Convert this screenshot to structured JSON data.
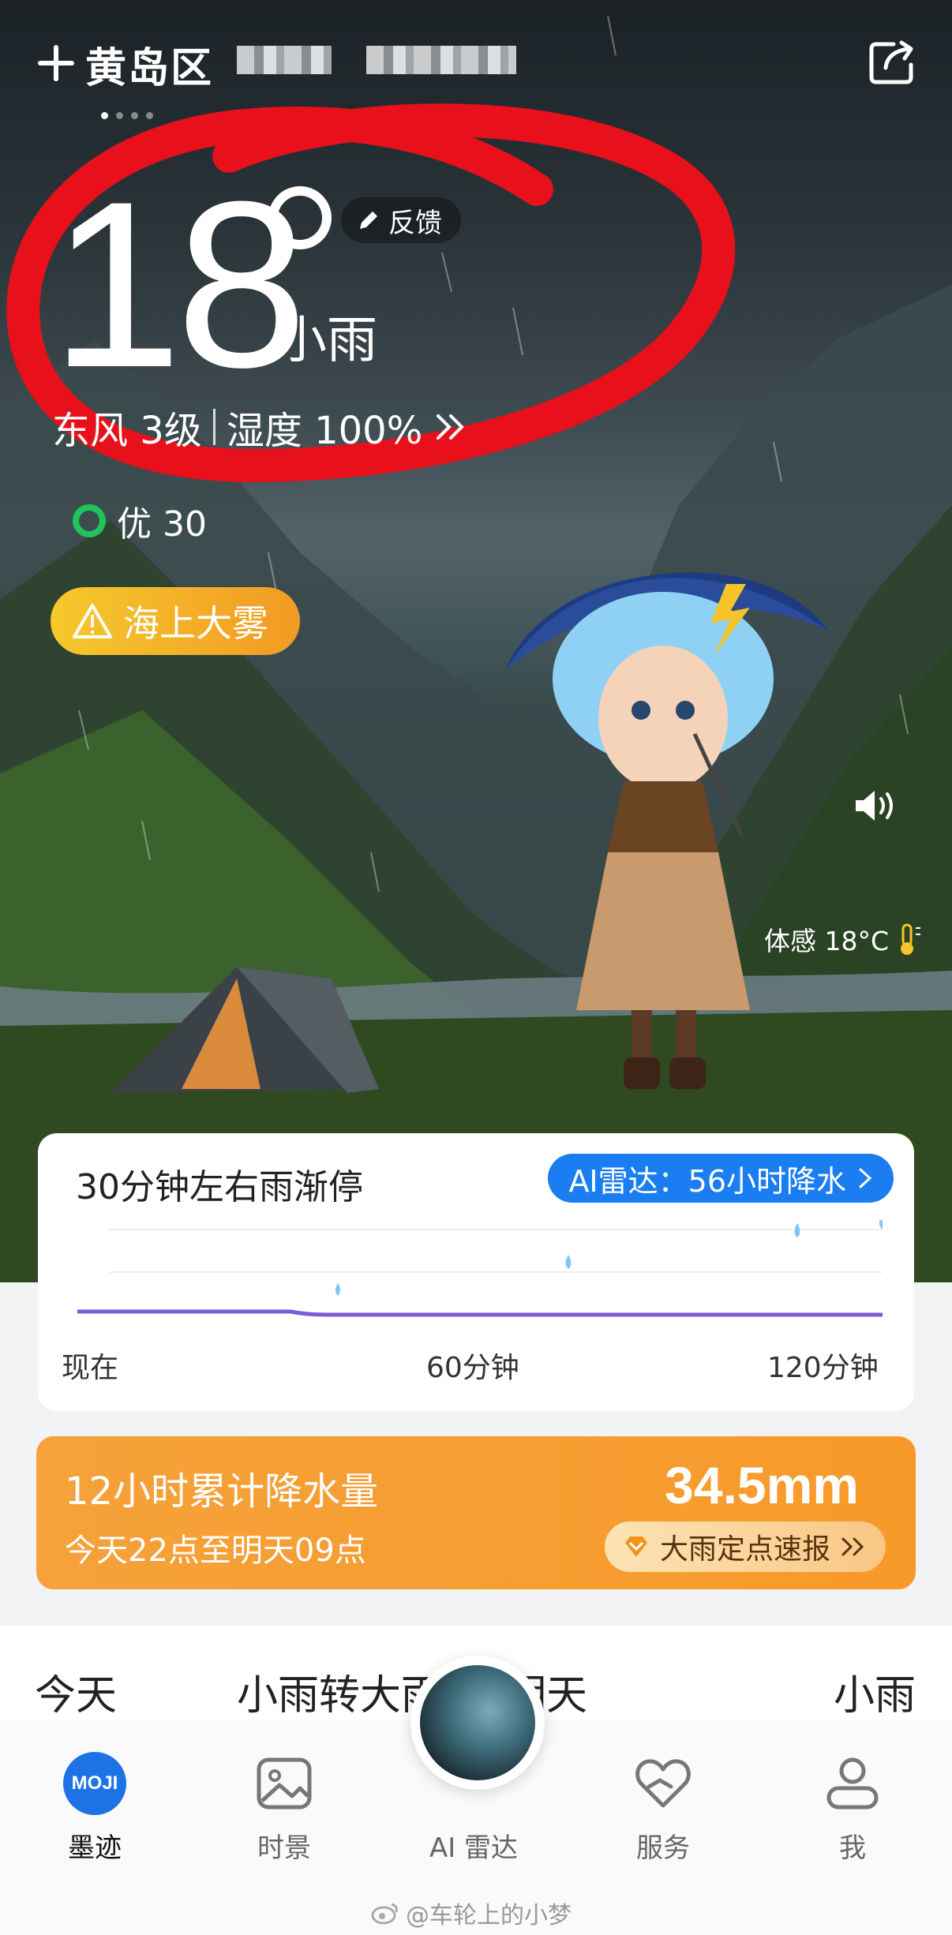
{
  "header": {
    "location": "黄岛区",
    "location_suffix": "",
    "page_count": 4,
    "active_page": 0
  },
  "current": {
    "temperature": "18",
    "condition": "小雨",
    "feedback_label": "反馈",
    "wind": "东风 3级",
    "humidity": "湿度 100%",
    "aqi_label": "优 30",
    "alert": "海上大雾",
    "feels_like": "体感 18°C"
  },
  "nowcast": {
    "title": "30分钟左右雨渐停",
    "radar_label": "AI雷达：56小时降水",
    "ticks": [
      "现在",
      "60分钟",
      "120分钟"
    ]
  },
  "precipitation": {
    "title": "12小时累计降水量",
    "period": "今天22点至明天09点",
    "value": "34.5mm",
    "report_label": "大雨定点速报"
  },
  "forecast": {
    "today_label": "今天",
    "today_condition": "小雨转大雨",
    "tomorrow_label": "明天",
    "tomorrow_condition": "小雨"
  },
  "tabs": [
    {
      "label": "墨迹",
      "icon": "moji-logo",
      "active": true
    },
    {
      "label": "时景",
      "icon": "image-icon",
      "active": false
    },
    {
      "label": "AI 雷达",
      "icon": "radar-orb",
      "active": false
    },
    {
      "label": "服务",
      "icon": "heart-hand-icon",
      "active": false
    },
    {
      "label": "我",
      "icon": "person-icon",
      "active": false
    }
  ],
  "watermark": "@车轮上的小梦",
  "colors": {
    "accent_blue": "#1a7df2",
    "precip_orange": "#f79a2a",
    "alert_yellow": "#f5c92c",
    "aqi_green": "#21c45a",
    "annotation_red": "#e8101a"
  }
}
